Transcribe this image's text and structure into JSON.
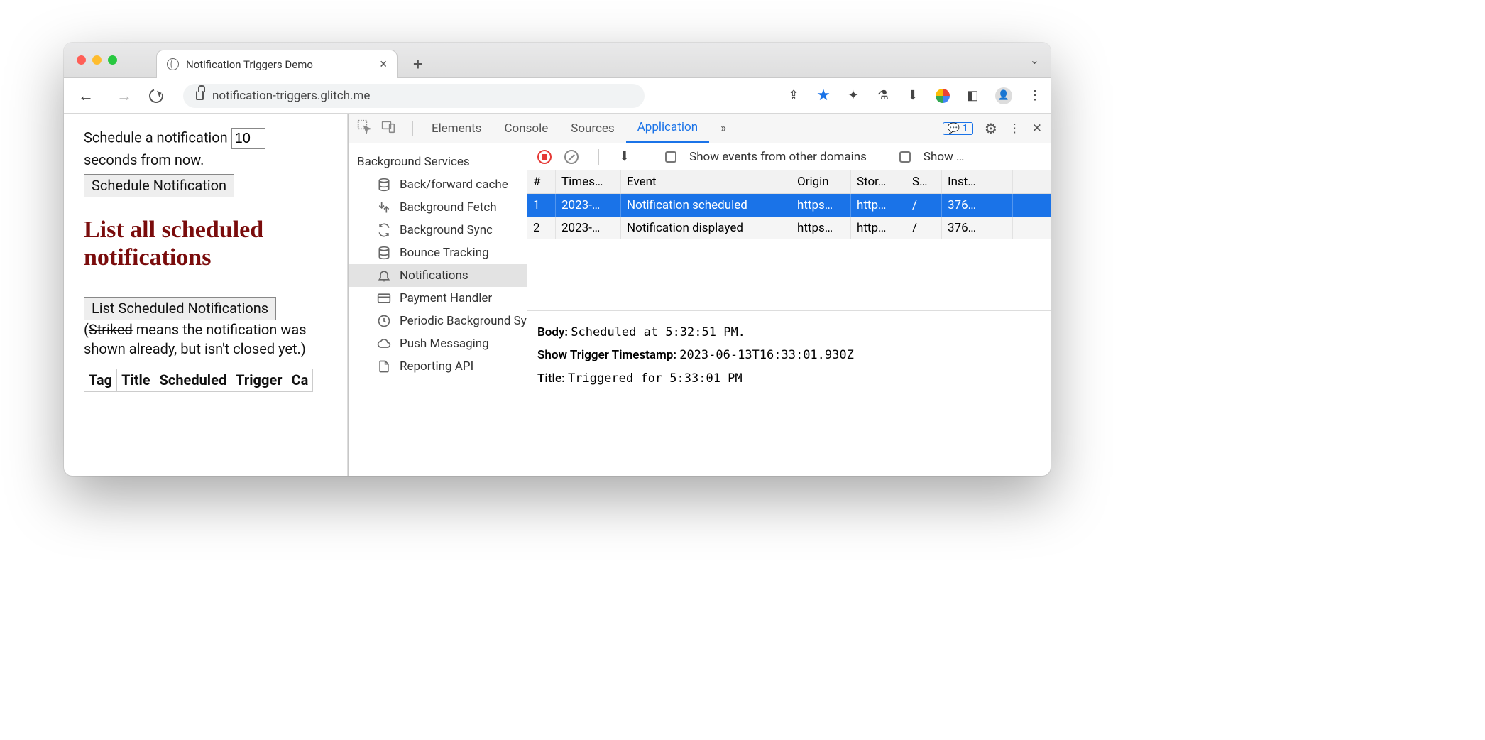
{
  "tab": {
    "title": "Notification Triggers Demo"
  },
  "url_host": "notification-triggers.glitch.me",
  "page": {
    "schedule_prefix": "Schedule a notification ",
    "schedule_value": "10",
    "schedule_suffix": " seconds from now.",
    "btn_schedule": "Schedule Notification",
    "heading": "List all scheduled notifications",
    "btn_list": "List Scheduled Notifications",
    "note_open": "(",
    "note_striked": "Striked",
    "note_rest": " means the notification was shown already, but isn't closed yet.)",
    "cols": [
      "Tag",
      "Title",
      "Scheduled",
      "Trigger",
      "Ca"
    ]
  },
  "devtools": {
    "tabs": [
      "Elements",
      "Console",
      "Sources",
      "Application"
    ],
    "more": "»",
    "issues_count": "1",
    "sidebar_heading": "Background Services",
    "sidebar": [
      "Back/forward cache",
      "Background Fetch",
      "Background Sync",
      "Bounce Tracking",
      "Notifications",
      "Payment Handler",
      "Periodic Background Sync",
      "Push Messaging",
      "Reporting API"
    ],
    "checkbox1": "Show events from other domains",
    "checkbox2": "Show …",
    "columns": [
      "#",
      "Times…",
      "Event",
      "Origin",
      "Stor…",
      "S…",
      "Inst…"
    ],
    "rows": [
      {
        "n": "1",
        "ts": "2023-…",
        "event": "Notification scheduled",
        "origin": "https…",
        "stor": "http…",
        "s": "/",
        "inst": "376…"
      },
      {
        "n": "2",
        "ts": "2023-…",
        "event": "Notification displayed",
        "origin": "https…",
        "stor": "http…",
        "s": "/",
        "inst": "376…"
      }
    ],
    "detail": {
      "body_k": "Body:",
      "body_v": "Scheduled at 5:32:51 PM.",
      "ts_k": "Show Trigger Timestamp:",
      "ts_v": "2023-06-13T16:33:01.930Z",
      "title_k": "Title:",
      "title_v": "Triggered for 5:33:01 PM"
    }
  }
}
